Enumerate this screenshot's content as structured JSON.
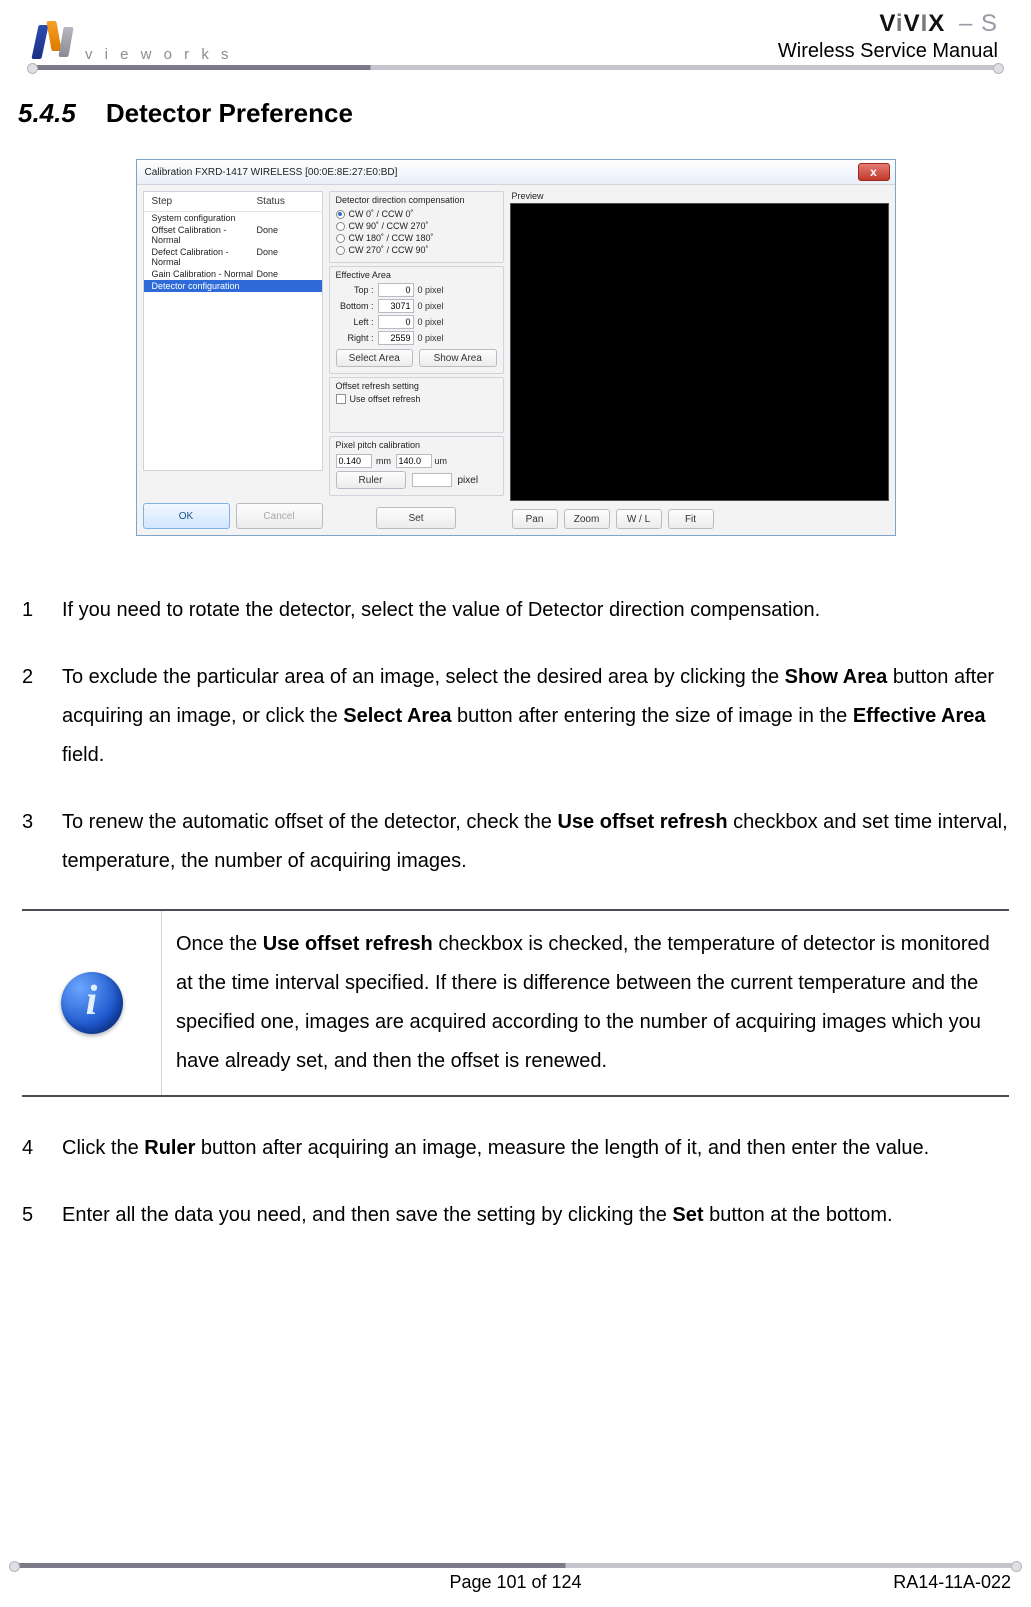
{
  "header": {
    "logo_text": "v i e w o r k s",
    "product_brand": "ViVIX",
    "product_suffix": " – S",
    "doc_title": "Wireless Service Manual"
  },
  "section": {
    "number": "5.4.5",
    "title": "Detector Preference"
  },
  "screenshot": {
    "window_title": "Calibration   FXRD-1417 WIRELESS [00:0E:8E:27:E0:BD]",
    "close_glyph": "x",
    "steplist": {
      "headers": {
        "step": "Step",
        "status": "Status"
      },
      "rows": [
        {
          "step": "System configuration",
          "status": ""
        },
        {
          "step": "Offset Calibration - Normal",
          "status": "Done"
        },
        {
          "step": "Defect Calibration - Normal",
          "status": "Done"
        },
        {
          "step": "Gain Calibration - Normal",
          "status": "Done"
        },
        {
          "step": "Detector configuration",
          "status": "",
          "selected": true
        }
      ]
    },
    "ok_label": "OK",
    "cancel_label": "Cancel",
    "direction": {
      "title": "Detector direction compensation",
      "options": [
        "CW 0˚ / CCW 0˚",
        "CW 90˚ / CCW 270˚",
        "CW 180˚  / CCW 180˚",
        "CW 270˚ / CCW 90˚"
      ],
      "selected_index": 0
    },
    "effective_area": {
      "title": "Effective Area",
      "rows": [
        {
          "label": "Top :",
          "value": "0",
          "unit": "0 pixel"
        },
        {
          "label": "Bottom :",
          "value": "3071",
          "unit": "0 pixel"
        },
        {
          "label": "Left :",
          "value": "0",
          "unit": "0 pixel"
        },
        {
          "label": "Right :",
          "value": "2559",
          "unit": "0 pixel"
        }
      ],
      "select_area": "Select Area",
      "show_area": "Show Area"
    },
    "offset_refresh": {
      "title": "Offset refresh setting",
      "checkbox_label": "Use offset refresh",
      "checked": false
    },
    "pixel_pitch": {
      "title": "Pixel pitch calibration",
      "mm_value": "0.140",
      "mm_unit": "mm",
      "um_value": "140.0",
      "um_unit": "um",
      "ruler_label": "Ruler",
      "pixel_unit": "pixel"
    },
    "set_label": "Set",
    "preview": {
      "title": "Preview",
      "buttons": [
        "Pan",
        "Zoom",
        "W / L",
        "Fit"
      ]
    }
  },
  "instructions": {
    "i1": {
      "num": "1",
      "text": "If you need to rotate the detector, select the value of Detector direction compensation."
    },
    "i2": {
      "num": "2",
      "pre": "To exclude the particular area of an image, select the desired area by clicking the ",
      "b1": "Show Area",
      "mid1": " button after acquiring an image, or click the ",
      "b2": "Select Area",
      "mid2": " button after entering the size of image in the ",
      "b3": "Effective Area",
      "post": " field."
    },
    "i3": {
      "num": "3",
      "pre": "To renew the automatic offset of the detector, check the ",
      "b1": "Use offset refresh",
      "post": " checkbox and set time interval, temperature, the number of acquiring images."
    },
    "info": {
      "pre": "Once the ",
      "b1": "Use offset refresh",
      "post": " checkbox is checked, the temperature of detector is monitored at the time interval specified. If there is difference between the current temperature and the specified one, images are acquired according to the number of acquiring images which you have already set, and then the offset is renewed."
    },
    "i4": {
      "num": "4",
      "pre": "Click the ",
      "b1": "Ruler",
      "post": " button after acquiring an image, measure the length of it, and then enter the value."
    },
    "i5": {
      "num": "5",
      "pre": "Enter all the data you need, and then save the setting by clicking the ",
      "b1": "Set",
      "post": " button at the bottom."
    }
  },
  "footer": {
    "page": "Page 101 of 124",
    "docnum": "RA14-11A-022"
  }
}
